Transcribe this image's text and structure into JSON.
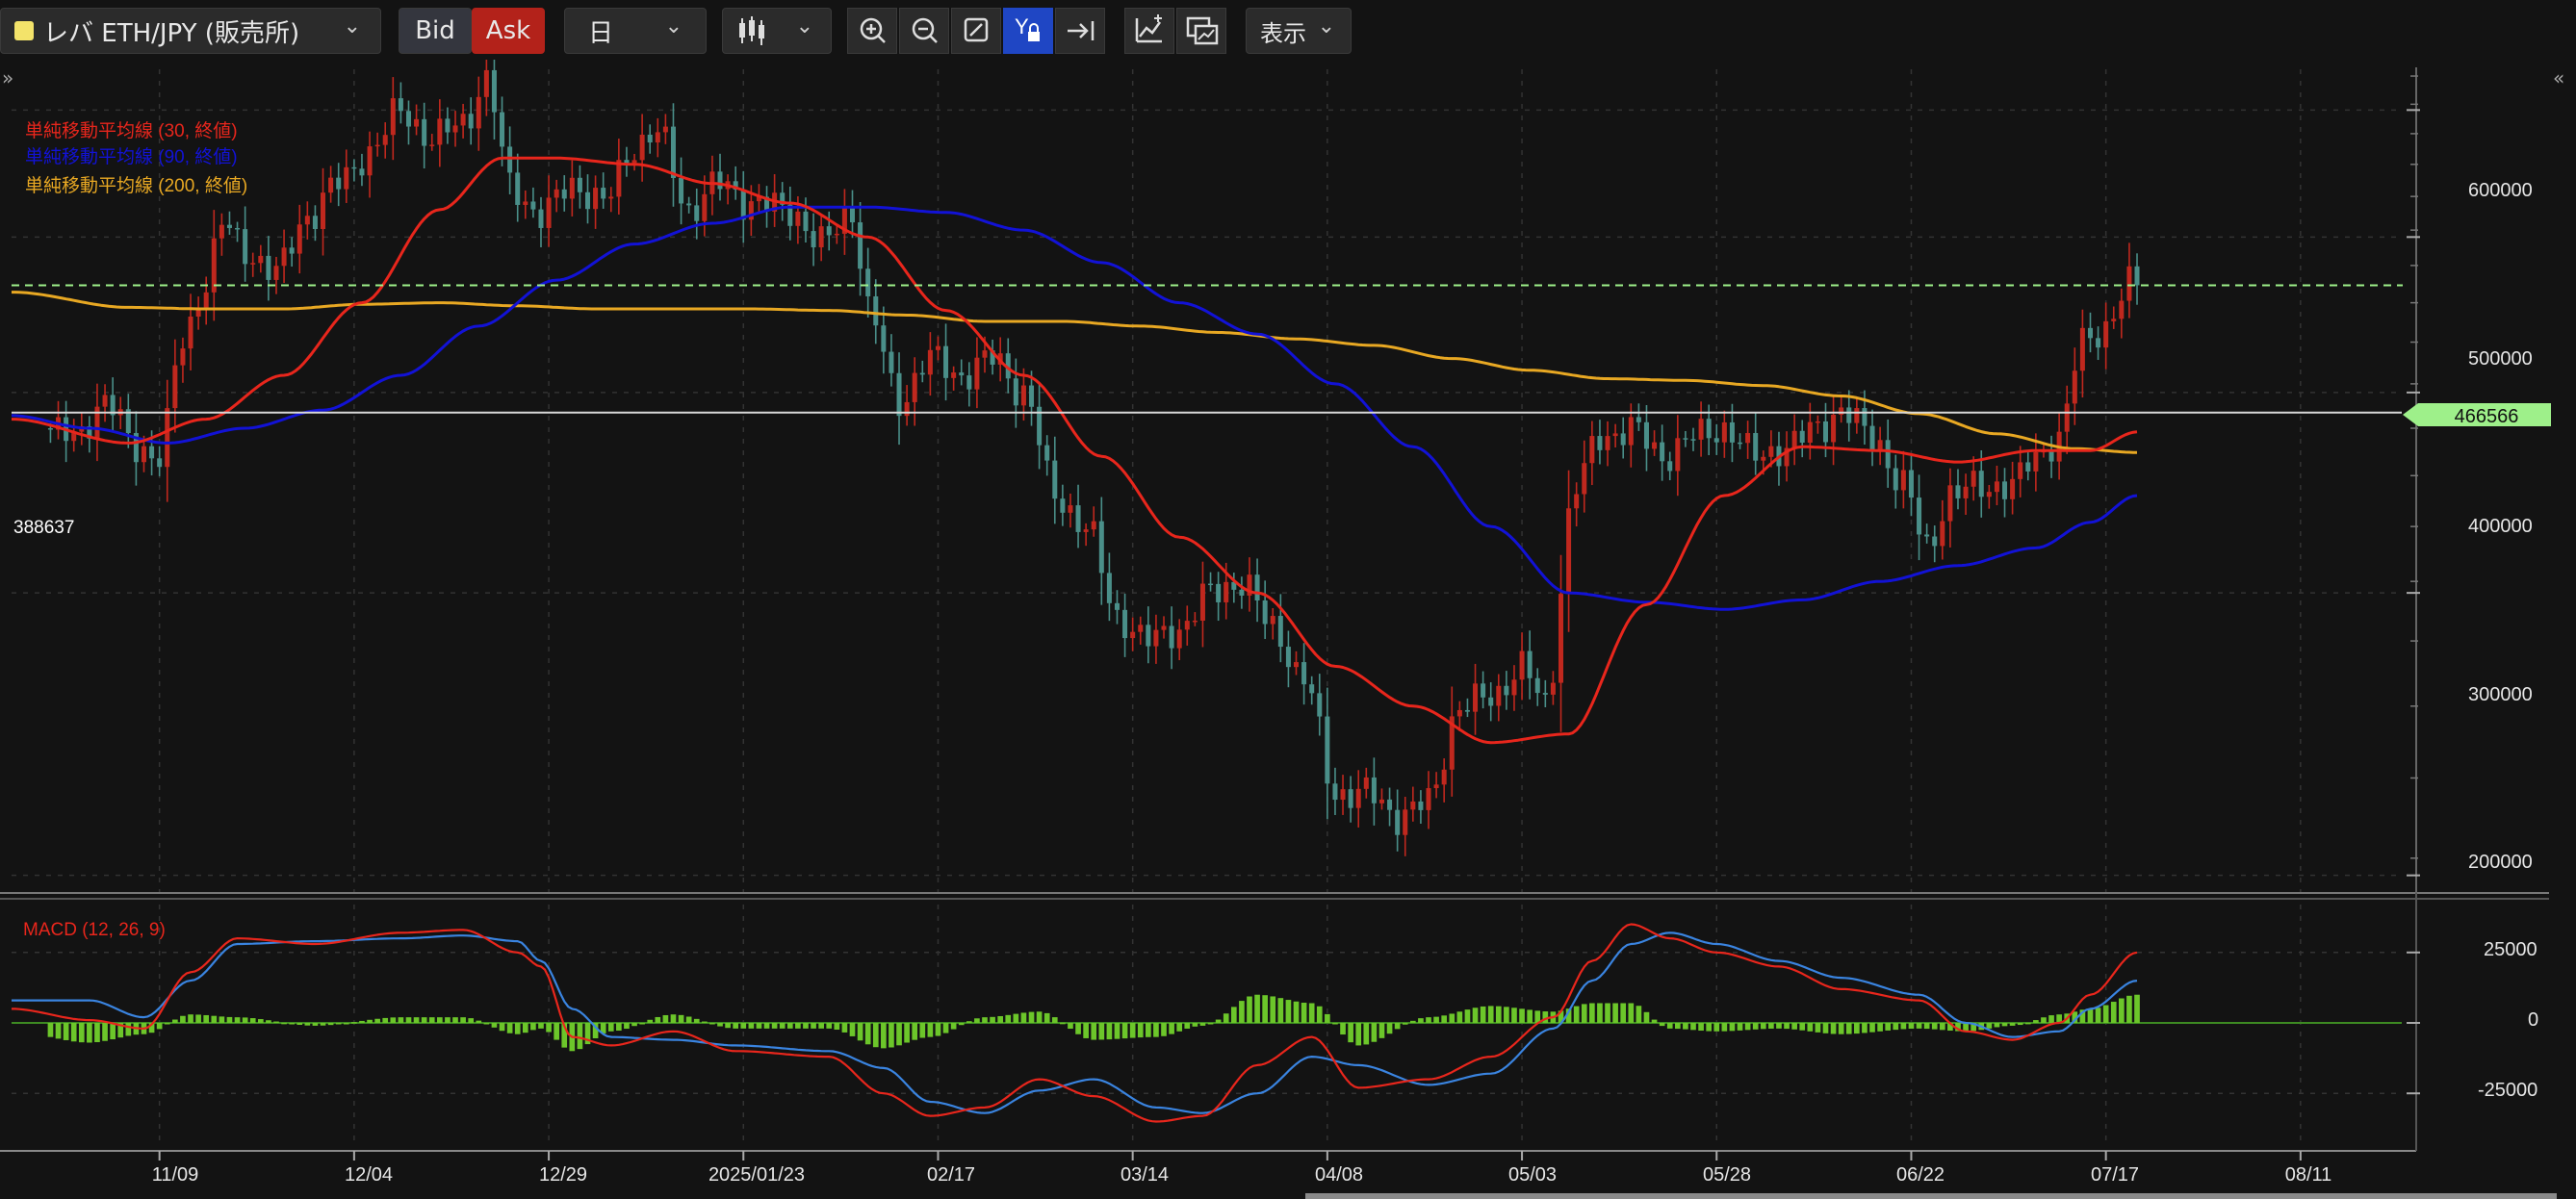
{
  "toolbar": {
    "symbol": "レバ ETH/JPY (販売所)",
    "bid": "Bid",
    "ask": "Ask",
    "interval": "日",
    "display": "表示",
    "chevron": "⌄",
    "icons": [
      "candlestick-icon",
      "zoom-in-icon",
      "zoom-out-icon",
      "fit-icon",
      "y-lock-icon",
      "jump-to-latest-icon",
      "add-indicator-icon",
      "compare-icon"
    ]
  },
  "colors": {
    "background": "#131313",
    "grid": "#333333",
    "up": "#c0281e",
    "down": "#4a8f89",
    "sma30": "#e8261c",
    "sma90": "#1212d6",
    "sma200": "#e8a823",
    "macd": "#e8261c",
    "signal": "#3a84e0",
    "hist": "#6cc62a",
    "price_tag": "#9ef08a"
  },
  "chart_data": {
    "type": "candlestick",
    "legend": [
      {
        "label": "単純移動平均線 (30, 終値)",
        "color": "#e8261c"
      },
      {
        "label": "単純移動平均線 (90, 終値)",
        "color": "#1212d6"
      },
      {
        "label": "単純移動平均線 (200, 終値)",
        "color": "#e8a823"
      }
    ],
    "y_ticks": [
      "600000",
      "500000",
      "400000",
      "300000",
      "200000"
    ],
    "y_tick_values": [
      600000,
      500000,
      400000,
      300000,
      200000
    ],
    "ylim": [
      195000,
      645000
    ],
    "x_ticks": [
      "11/09",
      "12/04",
      "12/29",
      "2025/01/23",
      "02/17",
      "03/14",
      "04/08",
      "05/03",
      "05/28",
      "06/22",
      "07/17",
      "08/11"
    ],
    "x_tick_days": [
      14,
      39,
      64,
      89,
      114,
      139,
      164,
      189,
      214,
      239,
      264,
      289
    ],
    "xlim": [
      -5,
      302
    ],
    "last_price": 466566,
    "last_price_label": "466566",
    "h_line_price": 388637,
    "h_line_label": "388637",
    "price_anchors": [
      [
        0,
        380000
      ],
      [
        4,
        375000
      ],
      [
        8,
        395000
      ],
      [
        12,
        370000
      ],
      [
        15,
        365000
      ],
      [
        18,
        430000
      ],
      [
        21,
        470000
      ],
      [
        23,
        510000
      ],
      [
        26,
        490000
      ],
      [
        30,
        475000
      ],
      [
        34,
        515000
      ],
      [
        38,
        540000
      ],
      [
        42,
        565000
      ],
      [
        46,
        600000
      ],
      [
        50,
        575000
      ],
      [
        54,
        590000
      ],
      [
        57,
        625000
      ],
      [
        60,
        540000
      ],
      [
        64,
        515000
      ],
      [
        68,
        540000
      ],
      [
        72,
        525000
      ],
      [
        76,
        570000
      ],
      [
        79,
        580000
      ],
      [
        83,
        520000
      ],
      [
        87,
        540000
      ],
      [
        91,
        525000
      ],
      [
        96,
        520000
      ],
      [
        100,
        495000
      ],
      [
        104,
        520000
      ],
      [
        106,
        450000
      ],
      [
        110,
        395000
      ],
      [
        114,
        420000
      ],
      [
        118,
        410000
      ],
      [
        122,
        420000
      ],
      [
        126,
        400000
      ],
      [
        130,
        345000
      ],
      [
        134,
        330000
      ],
      [
        138,
        290000
      ],
      [
        142,
        280000
      ],
      [
        146,
        285000
      ],
      [
        150,
        300000
      ],
      [
        154,
        305000
      ],
      [
        158,
        285000
      ],
      [
        162,
        265000
      ],
      [
        166,
        225000
      ],
      [
        170,
        225000
      ],
      [
        174,
        218000
      ],
      [
        178,
        222000
      ],
      [
        182,
        255000
      ],
      [
        186,
        258000
      ],
      [
        190,
        270000
      ],
      [
        193,
        255000
      ],
      [
        197,
        350000
      ],
      [
        200,
        375000
      ],
      [
        204,
        380000
      ],
      [
        208,
        365000
      ],
      [
        212,
        375000
      ],
      [
        216,
        380000
      ],
      [
        220,
        365000
      ],
      [
        224,
        370000
      ],
      [
        228,
        380000
      ],
      [
        231,
        390000
      ],
      [
        235,
        375000
      ],
      [
        239,
        350000
      ],
      [
        242,
        320000
      ],
      [
        245,
        345000
      ],
      [
        249,
        350000
      ],
      [
        253,
        350000
      ],
      [
        256,
        365000
      ],
      [
        259,
        375000
      ],
      [
        262,
        430000
      ],
      [
        265,
        440000
      ],
      [
        268,
        466566
      ]
    ],
    "sma30_points": [
      [
        -5,
        385000
      ],
      [
        10,
        372000
      ],
      [
        20,
        385000
      ],
      [
        30,
        410000
      ],
      [
        40,
        455000
      ],
      [
        50,
        520000
      ],
      [
        58,
        560000
      ],
      [
        65,
        560000
      ],
      [
        75,
        555000
      ],
      [
        85,
        540000
      ],
      [
        95,
        525000
      ],
      [
        105,
        500000
      ],
      [
        115,
        450000
      ],
      [
        125,
        410000
      ],
      [
        135,
        365000
      ],
      [
        145,
        325000
      ],
      [
        155,
        300000
      ],
      [
        165,
        270000
      ],
      [
        175,
        255000
      ],
      [
        185,
        242000
      ],
      [
        195,
        245000
      ],
      [
        205,
        295000
      ],
      [
        215,
        345000
      ],
      [
        225,
        370000
      ],
      [
        235,
        368000
      ],
      [
        245,
        362000
      ],
      [
        255,
        368000
      ],
      [
        262,
        368000
      ],
      [
        268,
        378000
      ]
    ],
    "sma90_points": [
      [
        -5,
        387000
      ],
      [
        5,
        380000
      ],
      [
        15,
        372000
      ],
      [
        25,
        380000
      ],
      [
        35,
        390000
      ],
      [
        45,
        410000
      ],
      [
        55,
        440000
      ],
      [
        65,
        470000
      ],
      [
        75,
        495000
      ],
      [
        85,
        510000
      ],
      [
        95,
        522000
      ],
      [
        105,
        522000
      ],
      [
        115,
        518000
      ],
      [
        125,
        505000
      ],
      [
        135,
        482000
      ],
      [
        145,
        455000
      ],
      [
        155,
        435000
      ],
      [
        165,
        405000
      ],
      [
        175,
        370000
      ],
      [
        185,
        330000
      ],
      [
        195,
        300000
      ],
      [
        205,
        296000
      ],
      [
        215,
        293000
      ],
      [
        225,
        297000
      ],
      [
        235,
        305000
      ],
      [
        245,
        312000
      ],
      [
        255,
        320000
      ],
      [
        262,
        332000
      ],
      [
        268,
        345000
      ]
    ],
    "sma200_points": [
      [
        -5,
        462000
      ],
      [
        10,
        452000
      ],
      [
        20,
        451000
      ],
      [
        30,
        451000
      ],
      [
        40,
        454000
      ],
      [
        50,
        455000
      ],
      [
        60,
        453000
      ],
      [
        70,
        451000
      ],
      [
        80,
        451000
      ],
      [
        90,
        451000
      ],
      [
        100,
        450000
      ],
      [
        110,
        447000
      ],
      [
        120,
        443000
      ],
      [
        130,
        443000
      ],
      [
        140,
        440000
      ],
      [
        150,
        436000
      ],
      [
        160,
        432000
      ],
      [
        170,
        428000
      ],
      [
        180,
        420000
      ],
      [
        190,
        413000
      ],
      [
        200,
        408000
      ],
      [
        210,
        407000
      ],
      [
        220,
        404000
      ],
      [
        230,
        398000
      ],
      [
        240,
        388000
      ],
      [
        250,
        377000
      ],
      [
        260,
        369000
      ],
      [
        268,
        367000
      ]
    ],
    "macd": {
      "title": "MACD (12, 26, 9)",
      "y_ticks": [
        "25000",
        "0",
        "-25000"
      ],
      "y_tick_values": [
        25000,
        0,
        -25000
      ],
      "ylim": [
        -42000,
        42000
      ],
      "macd_points": [
        [
          -5,
          5000
        ],
        [
          5,
          1000
        ],
        [
          12,
          -2000
        ],
        [
          18,
          18000
        ],
        [
          24,
          30000
        ],
        [
          34,
          28000
        ],
        [
          45,
          32000
        ],
        [
          53,
          33000
        ],
        [
          60,
          25000
        ],
        [
          63,
          20000
        ],
        [
          67,
          -5000
        ],
        [
          72,
          -8000
        ],
        [
          80,
          -3000
        ],
        [
          88,
          -10000
        ],
        [
          100,
          -12000
        ],
        [
          107,
          -25000
        ],
        [
          113,
          -33000
        ],
        [
          120,
          -30000
        ],
        [
          127,
          -20000
        ],
        [
          134,
          -26000
        ],
        [
          142,
          -35000
        ],
        [
          148,
          -33000
        ],
        [
          155,
          -15000
        ],
        [
          162,
          -5000
        ],
        [
          168,
          -23000
        ],
        [
          177,
          -20000
        ],
        [
          185,
          -12000
        ],
        [
          193,
          2000
        ],
        [
          198,
          22000
        ],
        [
          203,
          35000
        ],
        [
          208,
          30000
        ],
        [
          214,
          25000
        ],
        [
          222,
          20000
        ],
        [
          230,
          12000
        ],
        [
          240,
          8000
        ],
        [
          246,
          -3000
        ],
        [
          252,
          -6000
        ],
        [
          258,
          0
        ],
        [
          262,
          10000
        ],
        [
          268,
          25000
        ]
      ],
      "signal_points": [
        [
          -5,
          8000
        ],
        [
          5,
          8000
        ],
        [
          12,
          2000
        ],
        [
          18,
          15000
        ],
        [
          24,
          28000
        ],
        [
          34,
          29000
        ],
        [
          45,
          30000
        ],
        [
          53,
          31000
        ],
        [
          60,
          29000
        ],
        [
          63,
          22000
        ],
        [
          67,
          5000
        ],
        [
          72,
          -5000
        ],
        [
          80,
          -6000
        ],
        [
          88,
          -8000
        ],
        [
          100,
          -10000
        ],
        [
          107,
          -16000
        ],
        [
          113,
          -28000
        ],
        [
          120,
          -32000
        ],
        [
          127,
          -24000
        ],
        [
          134,
          -20000
        ],
        [
          142,
          -30000
        ],
        [
          148,
          -32000
        ],
        [
          155,
          -25000
        ],
        [
          162,
          -12000
        ],
        [
          168,
          -15000
        ],
        [
          177,
          -22000
        ],
        [
          185,
          -18000
        ],
        [
          193,
          -2000
        ],
        [
          198,
          15000
        ],
        [
          203,
          28000
        ],
        [
          208,
          32000
        ],
        [
          214,
          28000
        ],
        [
          222,
          22000
        ],
        [
          230,
          16000
        ],
        [
          240,
          10000
        ],
        [
          246,
          0
        ],
        [
          252,
          -5000
        ],
        [
          258,
          -3000
        ],
        [
          262,
          5000
        ],
        [
          268,
          15000
        ]
      ]
    }
  }
}
